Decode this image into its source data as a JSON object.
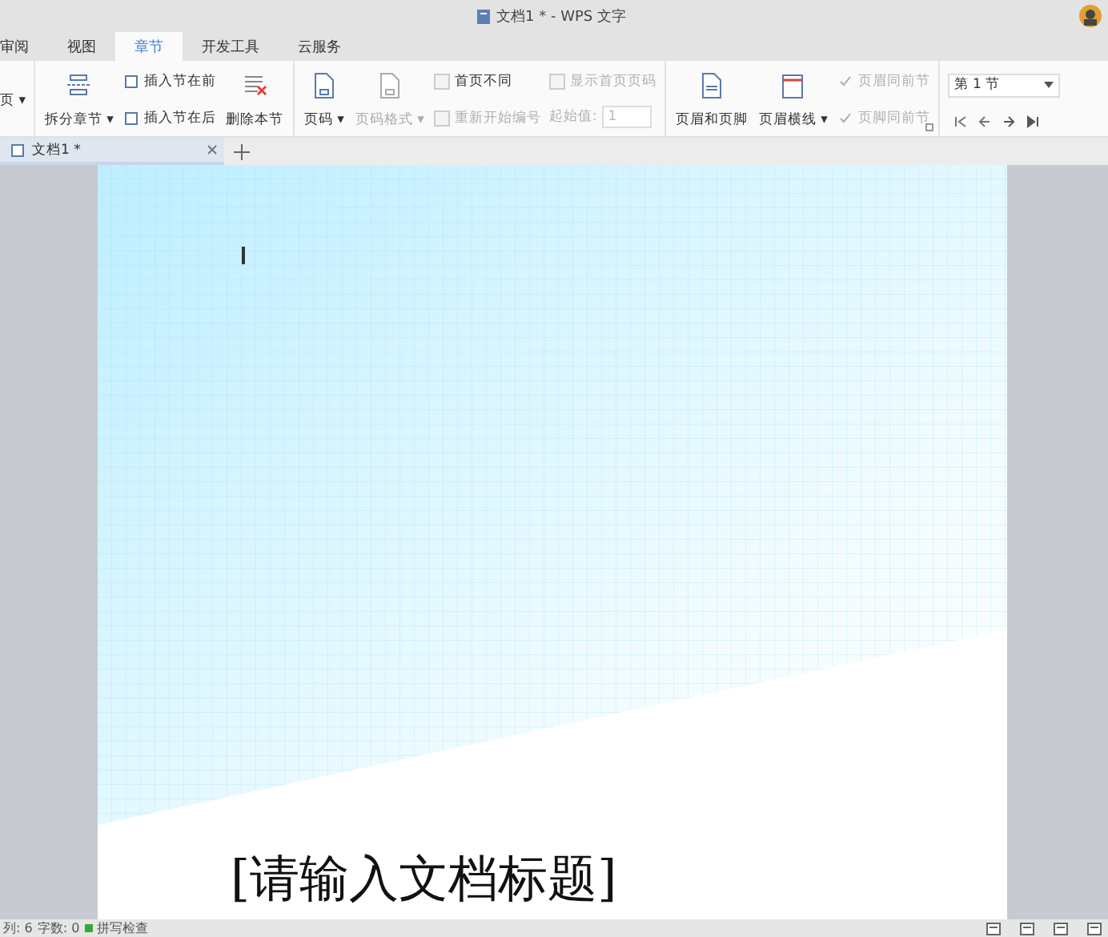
{
  "window": {
    "title": "文档1 * - WPS 文字"
  },
  "menu_tabs": [
    {
      "label": "审阅",
      "selected": false
    },
    {
      "label": "视图",
      "selected": false
    },
    {
      "label": "章节",
      "selected": true
    },
    {
      "label": "开发工具",
      "selected": false
    },
    {
      "label": "云服务",
      "selected": false
    }
  ],
  "ribbon": [
    {
      "columns": [
        [
          {
            "kind": "small",
            "label": "页 ▾",
            "disabled": false
          }
        ]
      ]
    },
    {
      "columns": [
        [
          {
            "kind": "large",
            "label": "拆分章节 ▾",
            "disabled": false
          }
        ],
        [
          {
            "kind": "small",
            "label": "插入节在前",
            "disabled": false
          },
          {
            "kind": "small",
            "label": "插入节在后",
            "disabled": false
          }
        ],
        [
          {
            "kind": "large",
            "label": "删除本节",
            "disabled": false
          }
        ]
      ]
    },
    {
      "columns": [
        [
          {
            "kind": "large",
            "label": "页码 ▾",
            "disabled": false
          }
        ],
        [
          {
            "kind": "large",
            "label": "页码格式 ▾",
            "disabled": true
          }
        ],
        [
          {
            "kind": "check",
            "label": "首页不同",
            "checked": false,
            "disabled": false
          },
          {
            "kind": "check",
            "label": "重新开始编号",
            "checked": false,
            "disabled": true
          }
        ],
        [
          {
            "kind": "check",
            "label": "显示首页页码",
            "checked": false,
            "disabled": true
          },
          {
            "kind": "input",
            "label": "起始值:",
            "value": "1",
            "disabled": true
          }
        ]
      ]
    },
    {
      "columns": [
        [
          {
            "kind": "large",
            "label": "页眉和页脚",
            "disabled": false
          }
        ],
        [
          {
            "kind": "large",
            "label": "页眉横线 ▾",
            "disabled": false
          }
        ],
        [
          {
            "kind": "check",
            "label": "页眉同前节",
            "checked": true,
            "disabled": true
          },
          {
            "kind": "check",
            "label": "页脚同前节",
            "checked": true,
            "disabled": true
          }
        ]
      ]
    },
    {
      "columns": [
        [
          {
            "kind": "dropdown",
            "value": "第 1 节",
            "disabled": false
          },
          {
            "kind": "nav",
            "disabled": false
          }
        ]
      ]
    }
  ],
  "doc_tabs": [
    {
      "label": "文档1 *",
      "selected": true
    }
  ],
  "document": {
    "title": "[请输入文档标题]"
  },
  "status_bar": [
    "列: 6",
    "字数: 0",
    "拼写检查"
  ]
}
